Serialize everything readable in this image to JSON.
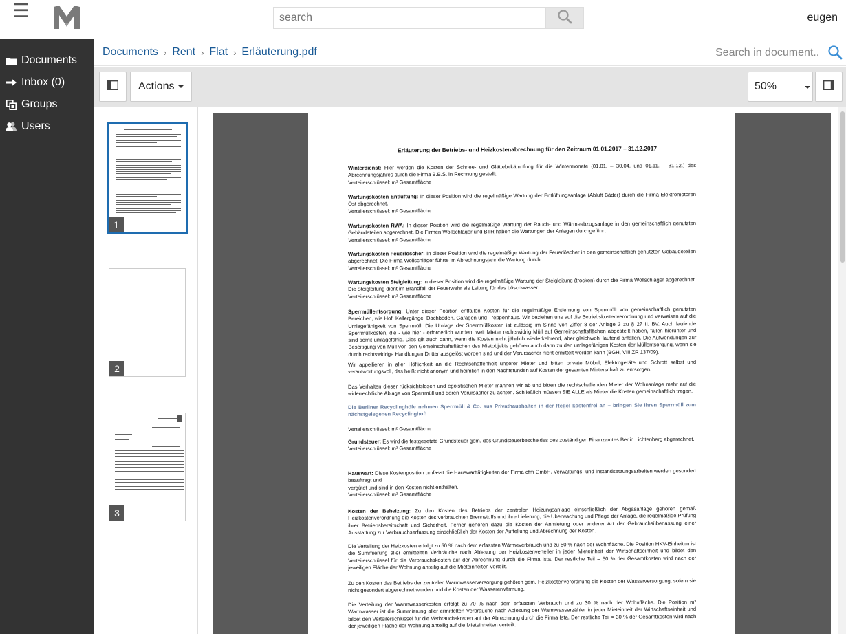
{
  "app": {
    "search_placeholder": "search",
    "username": "eugen"
  },
  "sidebar": {
    "items": [
      {
        "label": "Documents",
        "icon": "folder-icon"
      },
      {
        "label": "Inbox (0)",
        "icon": "arrow-right-icon"
      },
      {
        "label": "Groups",
        "icon": "groups-icon"
      },
      {
        "label": "Users",
        "icon": "users-icon"
      }
    ]
  },
  "breadcrumb": {
    "items": [
      "Documents",
      "Rent",
      "Flat",
      "Erläuterung.pdf"
    ],
    "separator": "›"
  },
  "doc_search_placeholder": "Search in document...",
  "toolbar": {
    "actions_label": "Actions",
    "zoom_value": "50%"
  },
  "thumbnails": [
    {
      "number": "1"
    },
    {
      "number": "2"
    },
    {
      "number": "3"
    }
  ],
  "document": {
    "title": "Erläuterung der Betriebs- und Heizkostenabrechnung für den Zeitraum 01.01.2017 – 31.12.2017",
    "sections": [
      {
        "heading": "Winterdienst:",
        "text": " Hier werden die Kosten der Schnee- und Glättebekämpfung für die Wintermonate (01.01. – 30.04. und 01.11. – 31.12.) des Abrechnungsjahres durch die Firma B.B.S. in Rechnung gestellt.",
        "key": "Verteilerschlüssel: m² Gesamtfläche"
      },
      {
        "heading": "Wartungskosten Entlüftung:",
        "text": " In dieser Position wird die regelmäßige Wartung der Entlüftungsanlage (Abluft Bäder) durch die Firma Elektromotoren Ost abgerechnet.",
        "key": "Verteilerschlüssel: m² Gesamtfläche"
      },
      {
        "heading": "Wartungskosten RWA:",
        "text": " In dieser Position wird die regelmäßige Wartung der Rauch- und Wärmeabzugsanlage in den gemeinschaftlich genutzten Gebäudeteilen abgerechnet. Die Firmen Wollschläger und BTR haben die Wartungen der Anlagen durchgeführt.",
        "key": "Verteilerschlüssel: m² Gesamtfläche"
      },
      {
        "heading": "Wartungskosten Feuerlöscher:",
        "text": " In dieser Position wird die regelmäßige Wartung der Feuerlöscher in den gemeinschaftlich genutzten Gebäudeteilen abgerechnet. Die Firma Wollschläger führte im Abrechnungsjahr die Wartung durch.",
        "key": "Verteilerschlüssel: m² Gesamtfläche"
      },
      {
        "heading": "Wartungskosten Steigleitung:",
        "text": " In dieser Position wird die regelmäßige Wartung der Steigleitung (trocken) durch die Firma Wollschläger abgerechnet. Die Steigleitung dient im Brandfall der Feuerwehr als Leitung für das Löschwasser.",
        "key": "Verteilerschlüssel: m² Gesamtfläche"
      },
      {
        "heading": "Sperrmüllentsorgung:",
        "text": " Unter dieser Position entfallen Kosten für die regelmäßige Entfernung von Sperrmüll von gemeinschaftlich genutzten Bereichen, wie Hof, Kellergänge, Dachboden, Garagen und Treppenhaus. Wir beziehen uns auf die Betriebskostenverordnung und verweisen auf die Umlagefähigkeit von Sperrmüll. Die Umlage der Sperrmüllkosten ist zulässig im Sinne von Ziffer 8 der Anlage 3 zu § 27 II. BV. Auch laufende Sperrmüllkosten, die - wie hier - erforderlich wurden, weil Mieter rechtswidrig Müll auf Gemeinschaftsflächen abgestellt haben, fallen hierunter und sind somit umlagefähig. Dies gilt auch dann, wenn die Kosten nicht jährlich wiederkehrend, aber gleichwohl laufend anfallen. Die Aufwendungen zur Beseitigung von Müll von den Gemeinschaftsflächen des Mietobjekts gehören auch dann zu den umlagefähigen Kosten der Müllentsorgung, wenn sie durch rechtswidrige Handlungen Dritter ausgelöst worden sind und der Verursacher nicht ermittelt werden kann (BGH, VIII ZR 137/09).",
        "key": ""
      }
    ],
    "appeal_1": "Wir appellieren in aller Höflichkeit an die Rechtschaffenheit unserer Mieter und bitten private Möbel, Elektrogeräte und Schrott selbst und verantwortungsvoll, das heißt nicht anonym und heimlich in den Nachtstunden auf Kosten der gesamten Mieterschaft zu entsorgen.",
    "appeal_2": "Das Verhalten dieser rücksichtslosen und egoistischen Mieter mahnen wir ab und bitten die rechtschaffenden Mieter der Wohnanlage mehr auf die widerrechtliche Ablage von Sperrmüll und deren Verursacher zu achten. Schließlich müssen SIE ALLE als Mieter die Kosten gemeinschaftlich tragen.",
    "recycling_note": "Die Berliner Recyclinghöfe nehmen Sperrmüll & Co. aus Privathaushalten in der Regel kostenfrei an – bringen Sie Ihren Sperrmüll zum nächstgelegenen Recyclinghof!",
    "key_after_recycling": "Verteilerschlüssel: m² Gesamtfläche",
    "grundsteuer": {
      "heading": "Grundsteuer:",
      "text": " Es wird die festgesetzte Grundsteuer gem. des Grundsteuerbescheides des zuständigen Finanzamtes Berlin Lichtenberg abgerechnet.",
      "key": "Verteilerschlüssel: m² Gesamtfläche"
    },
    "hauswart": {
      "heading": "Hauswart:",
      "text": " Diese Kostenposition umfasst die Hauswarttätigkeiten der Firma cfm GmbH. Verwaltungs- und Instandsetzungsarbeiten werden gesondert beauftragt und",
      "text2": "vergütet und sind in den Kosten nicht enthalten.",
      "key": "Verteilerschlüssel: m² Gesamtfläche"
    },
    "beheizung": {
      "heading": "Kosten der Beheizung:",
      "text": " Zu den Kosten des Betriebs der zentralen Heizungsanlage einschließlich der Abgasanlage gehören gemäß Heizkostenverordnung die Kosten des verbrauchten Brennstoffs und ihre Lieferung, die Überwachung und Pflege der Anlage, die regelmäßige Prüfung ihrer Betriebsbereitschaft und Sicherheit. Ferner gehören dazu die Kosten der Anmietung oder anderer Art der Gebrauchsüberlassung einer Ausstattung zur Verbrauchserfassung einschließlich der Kosten der Auftellung und Abrechnung der Kosten."
    },
    "verteilung_heiz": "Die Verteilung der Heizkosten erfolgt zu 50 % nach dem erfassten Wärmeverbrauch und zu 50 % nach der Wohnfläche. Die Position HKV-Einheiten ist die Summierung aller ermittelten Verbräuche nach Ablesung der Heizkostenverteiler in jeder Mieteinheit der Wirtschaftseinheit und bildet den Verteilerschlüssel für die Verbrauchskosten auf der Abrechnung durch die Firma Ista. Der restliche Teil = 50 % der Gesamtkosten wird nach der jeweiligen Fläche der Wohnung anteilig auf die Mieteinheiten verteilt.",
    "warmwasser": "Zu den Kosten des Betriebs der zentralen Warmwasserversorgung gehören gem. Heizkostenverordnung die Kosten der Wasserversorgung, sofern sie nicht gesondert abgerechnet werden und die Kosten der Wassererwärmung.",
    "verteilung_ww": "Die Verteilung der Warmwasserkosten erfolgt zu 70 % nach dem erfassten Verbrauch und zu 30 % nach der Wohnfläche. Die Position m³ Warmwasser ist die Summierung aller ermittelten Verbräuche nach Ablesung der Warmwasserzähler in jeder Mieteinheit der Wirtschaftseinheit und bildet den Verteilerschlüssel für die Verbrauchskosten auf der Abrechnung durch die Firma Ista. Der restliche Teil = 30 % der Gesamtkosten wird nach der jeweiligen Fläche der Wohnung anteilig auf die Mieteinheiten verteilt."
  }
}
